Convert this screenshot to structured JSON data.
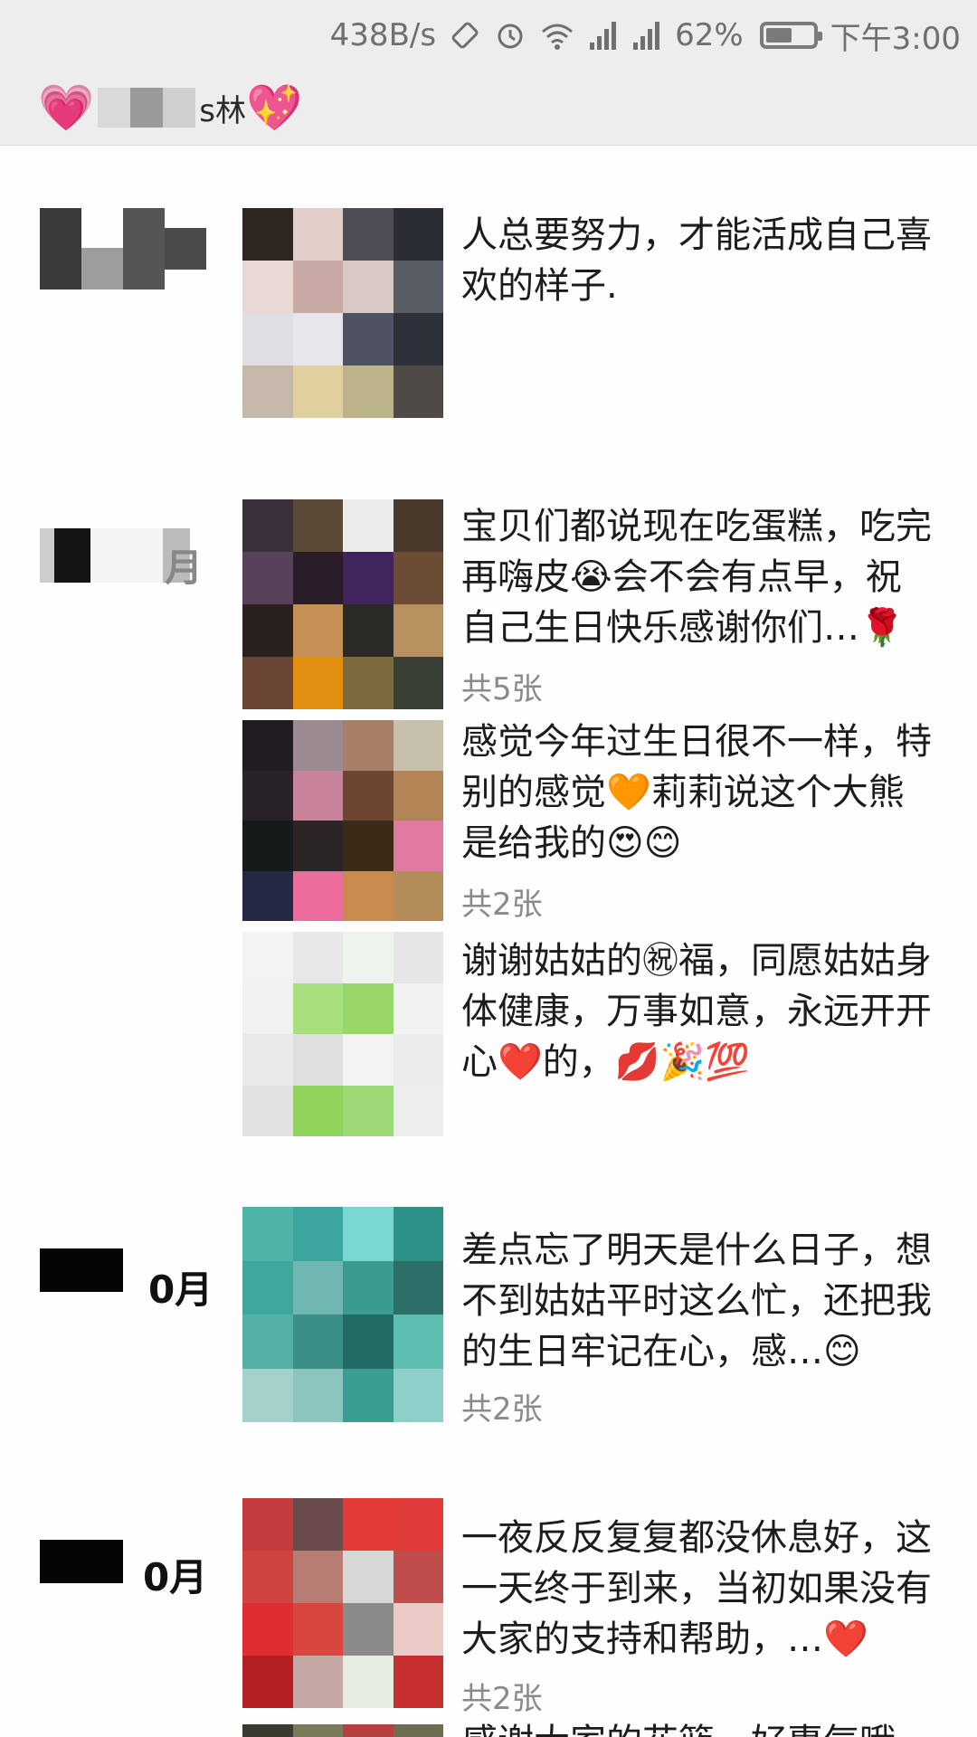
{
  "status": {
    "net_speed": "438B/s",
    "battery": "62%",
    "time": "下午3:00",
    "battery_level": 0.62
  },
  "title": {
    "left_emoji": "💗",
    "name_suffix": "s林",
    "right_emoji": "💖"
  },
  "posts": [
    {
      "text": "人总要努力，才能活成自己喜欢的样子.",
      "count": ""
    },
    {
      "month_suffix": "月",
      "text": "宝贝们都说现在吃蛋糕，吃完再嗨皮😭会不会有点早，祝自己生日快乐感谢你们…🌹",
      "count": "共5张"
    },
    {
      "text": "感觉今年过生日很不一样，特别的感觉🧡莉莉说这个大熊是给我的😍😊",
      "count": "共2张"
    },
    {
      "text": "谢谢姑姑的㊗福，同愿姑姑身体健康，万事如意，永远开开心❤️的，💋🎉💯",
      "count": ""
    },
    {
      "month_suffix": "0月",
      "text": "差点忘了明天是什么日子，想不到姑姑平时这么忙，还把我的生日牢记在心，感…😊",
      "count": "共2张"
    },
    {
      "month_suffix": "0月",
      "text": "一夜反反复复都没休息好，这一天终于到来，当初如果没有大家的支持和帮助，…❤️",
      "count": "共2张"
    },
    {
      "text": "感谢大家的花篮，好惠气哦",
      "count": ""
    }
  ],
  "colors": {
    "header_bg": "#ededed",
    "page_bg": "#fefefe",
    "count_text": "#8a8a8a"
  }
}
